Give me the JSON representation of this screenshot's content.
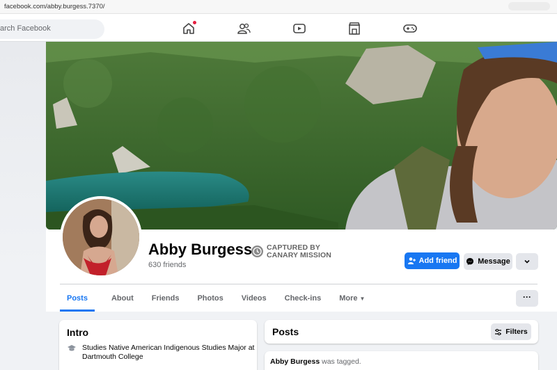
{
  "browser": {
    "url": "facebook.com/abby.burgess.7370/"
  },
  "topnav": {
    "search_placeholder": "arch Facebook",
    "icons": [
      "home-icon",
      "friends-icon",
      "watch-icon",
      "marketplace-icon",
      "gaming-icon"
    ],
    "notification_color": "#e41e3f"
  },
  "profile": {
    "name": "Abby Burgess",
    "friends": "630 friends",
    "captured_line1": "CAPTURED BY",
    "captured_line2": "CANARY MISSION",
    "add_friend": "Add friend",
    "message": "Message"
  },
  "tabs": [
    {
      "label": "Posts",
      "active": true
    },
    {
      "label": "About"
    },
    {
      "label": "Friends"
    },
    {
      "label": "Photos"
    },
    {
      "label": "Videos"
    },
    {
      "label": "Check-ins"
    },
    {
      "label": "More",
      "caret": "▼"
    }
  ],
  "tab_overflow": "···",
  "intro": {
    "title": "Intro",
    "education": "Studies Native American Indigenous Studies Major at Dartmouth College"
  },
  "posts": {
    "title": "Posts",
    "filters": "Filters",
    "tagged_name": "Abby Burgess",
    "tagged_text": " was tagged."
  },
  "colors": {
    "accent": "#1877f2",
    "background": "#f0f2f5",
    "button_gray": "#e4e6eb"
  }
}
